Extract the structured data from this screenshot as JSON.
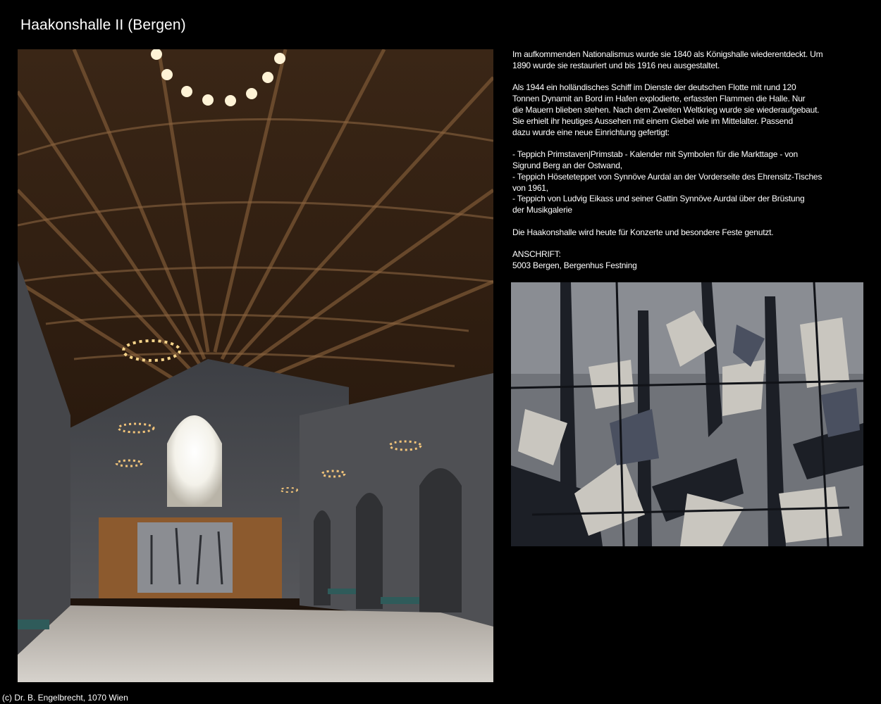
{
  "page": {
    "title": "Haakonshalle II (Bergen)",
    "footer": "(c) Dr. B. Engelbrecht, 1070 Wien"
  },
  "article": {
    "paragraph1": "Im aufkommenden Nationalismus wurde sie 1840 als Königshalle wiederentdeckt. Um\n1890 wurde sie restauriert und bis 1916 neu ausgestaltet.",
    "paragraph2": "Als 1944 ein holländisches Schiff im Dienste der deutschen Flotte mit rund 120\nTonnen Dynamit an Bord im Hafen explodierte, erfassten Flammen die Halle. Nur\ndie Mauern blieben stehen. Nach dem Zweiten Weltkrieg wurde sie wiederaufgebaut.\nSie erhielt ihr heutiges Aussehen mit einem Giebel wie im Mittelalter. Passend\ndazu wurde eine neue Einrichtung gefertigt:",
    "list": [
      "- Teppich Primstaven|Primstab - Kalender mit Symbolen für die Markttage -  von\n   Sigrund Berg an der Ostwand,",
      "- Teppich Höseteteppet von Synnöve Aurdal an der Vorderseite des Ehrensitz-Tisches\n   von 1961,",
      "- Teppich von Ludvig Eikass und seiner Gattin Synnöve Aurdal über der Brüstung\n   der Musikgalerie"
    ],
    "paragraph3": "Die Haakonshalle wird heute für Konzerte und besondere Feste genutzt.",
    "address_label": "ANSCHRIFT:",
    "address": "5003 Bergen, Bergenhus Festning"
  },
  "images": {
    "hall_photo": "hall-interior-photo",
    "tapestry_photo": "tapestry-photo"
  },
  "colors": {
    "background": "#000000",
    "text": "#ffffff"
  }
}
